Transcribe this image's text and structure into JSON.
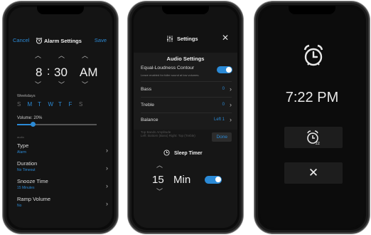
{
  "alarm_settings": {
    "cancel": "Cancel",
    "title": "Alarm Settings",
    "save": "Save",
    "hour": "8",
    "minute": "30",
    "ampm": "AM",
    "weekdays_label": "Weekdays",
    "days": [
      "S",
      "M",
      "T",
      "W",
      "T",
      "F",
      "S"
    ],
    "active_days": [
      1,
      2,
      3,
      4,
      5
    ],
    "volume_label": "Volume: 20%",
    "volume_fraction": 0.2,
    "section_label": "audio",
    "rows": [
      {
        "label": "Type",
        "value": "Alarm"
      },
      {
        "label": "Duration",
        "value": "No Timeout"
      },
      {
        "label": "Snooze Time",
        "value": "15 Minutes"
      },
      {
        "label": "Ramp Volume",
        "value": "No"
      }
    ]
  },
  "sleep_settings": {
    "title": "Settings",
    "audio_title": "Audio Settings",
    "elc_label": "Equal-Loudness Contour",
    "elc_sub": "Leave enabled for fuller sound at low volumes.",
    "elc_on": true,
    "rows": [
      {
        "label": "Bass",
        "value": "0"
      },
      {
        "label": "Treble",
        "value": "0"
      },
      {
        "label": "Balance",
        "value": "Left 1"
      }
    ],
    "ghost_text": "Top Bands Amplitude",
    "ghost_sub": "Left: Bottom (Bass) Right: Top (Treble)",
    "done": "Done",
    "sleep_timer": "Sleep Timer",
    "minutes": "15",
    "unit": "Min",
    "timer_on": true
  },
  "alarm_screen": {
    "time": "7:22 PM",
    "icons": [
      "alarm-clock-icon",
      "snooze-icon",
      "close-icon"
    ]
  },
  "colors": {
    "accent": "#2b8ad6",
    "background": "#141414"
  }
}
